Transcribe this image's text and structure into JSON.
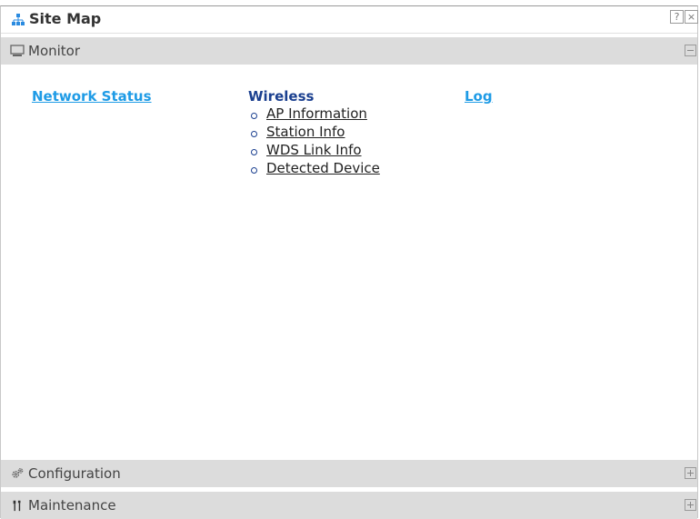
{
  "window": {
    "title": "Site Map",
    "help_label": "?",
    "close_label": "×"
  },
  "sections": {
    "monitor": {
      "label": "Monitor",
      "icon": "monitor-icon",
      "expanded": true,
      "links": {
        "network_status": "Network Status",
        "wireless": {
          "heading": "Wireless",
          "items": [
            "AP Information",
            "Station Info",
            "WDS Link Info",
            "Detected Device"
          ]
        },
        "log": "Log"
      }
    },
    "configuration": {
      "label": "Configuration",
      "icon": "gear-icon",
      "expanded": false
    },
    "maintenance": {
      "label": "Maintenance",
      "icon": "tools-icon",
      "expanded": false
    }
  },
  "colors": {
    "link_blue": "#1e9be6",
    "heading_navy": "#1a3f8f",
    "section_bar": "#dcdcdc"
  }
}
